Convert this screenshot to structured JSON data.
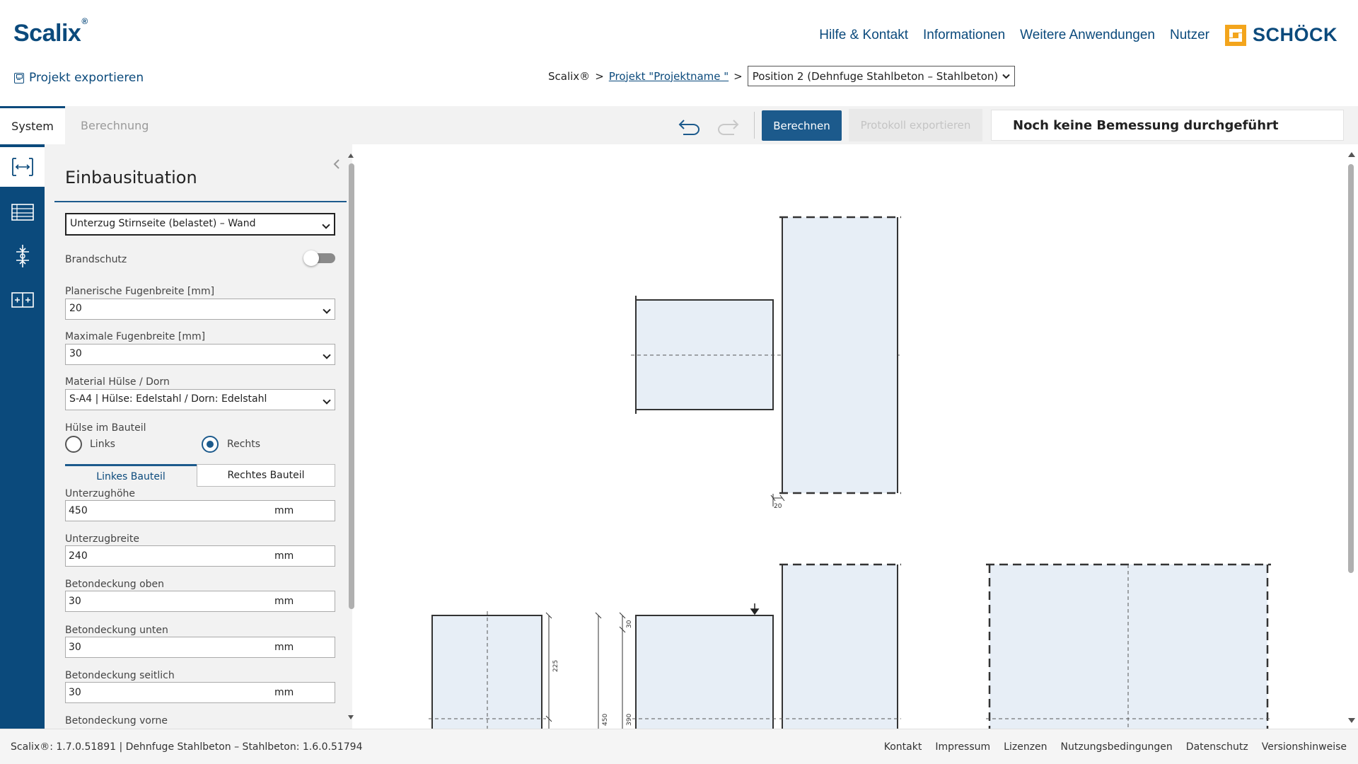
{
  "app": {
    "logo": "Scalix",
    "logo_mark": "®",
    "brand": "SCHÖCK",
    "brand_color": "#0b4a7c",
    "accent_color": "#f3a51c"
  },
  "topnav": {
    "help": "Hilfe & Kontakt",
    "info": "Informationen",
    "more_apps": "Weitere Anwendungen",
    "user": "Nutzer"
  },
  "export_project": "Projekt exportieren",
  "breadcrumb": {
    "root": "Scalix®",
    "sep": ">",
    "project": "Projekt \"Projektname \"",
    "position": "Position 2 (Dehnfuge Stahlbeton – Stahlbeton)"
  },
  "toolbar": {
    "tab_system": "System",
    "tab_calc": "Berechnung",
    "calc_button": "Berechnen",
    "export_protocol": "Protokoll exportieren",
    "status": "Noch keine Bemessung durchgeführt"
  },
  "rail": {
    "icons": [
      "joint-icon",
      "table-icon",
      "load-icon",
      "grid-icon"
    ]
  },
  "panel": {
    "title": "Einbausituation",
    "situation": "Unterzug Stirnseite (belastet) – Wand",
    "fire_protection": "Brandschutz",
    "joint_planned_label": "Planerische Fugenbreite [mm]",
    "joint_planned_value": "20",
    "joint_max_label": "Maximale Fugenbreite [mm]",
    "joint_max_value": "30",
    "material_label": "Material Hülse / Dorn",
    "material_value": "S-A4 | Hülse: Edelstahl / Dorn: Edelstahl",
    "sleeve_label": "Hülse im Bauteil",
    "sleeve_left": "Links",
    "sleeve_right": "Rechts",
    "sleeve_selected": "Rechts",
    "tab_left": "Linkes Bauteil",
    "tab_right": "Rechtes Bauteil",
    "fields": [
      {
        "label": "Unterzughöhe",
        "value": "450",
        "unit": "mm"
      },
      {
        "label": "Unterzugbreite",
        "value": "240",
        "unit": "mm"
      },
      {
        "label": "Betondeckung oben",
        "value": "30",
        "unit": "mm"
      },
      {
        "label": "Betondeckung unten",
        "value": "30",
        "unit": "mm"
      },
      {
        "label": "Betondeckung seitlich",
        "value": "30",
        "unit": "mm"
      },
      {
        "label": "Betondeckung vorne",
        "value": "",
        "unit": ""
      }
    ]
  },
  "drawing": {
    "dim_joint": "20",
    "dim_225": "225",
    "dim_450": "450",
    "dim_30": "30",
    "dim_390": "390"
  },
  "footer": {
    "version": "Scalix®: 1.7.0.51891 | Dehnfuge Stahlbeton – Stahlbeton: 1.6.0.51794",
    "links": [
      "Kontakt",
      "Impressum",
      "Lizenzen",
      "Nutzungsbedingungen",
      "Datenschutz",
      "Versionshinweise"
    ]
  }
}
